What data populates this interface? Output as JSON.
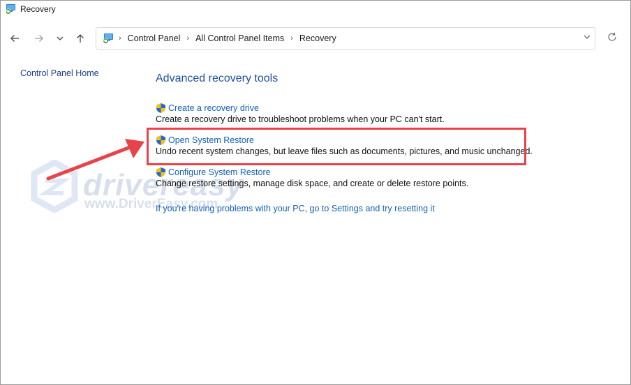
{
  "window": {
    "title": "Recovery"
  },
  "address": {
    "crumbs": [
      "Control Panel",
      "All Control Panel Items",
      "Recovery"
    ]
  },
  "left_pane": {
    "home_link": "Control Panel Home"
  },
  "main": {
    "heading": "Advanced recovery tools",
    "items": [
      {
        "label": "Create a recovery drive",
        "description": "Create a recovery drive to troubleshoot problems when your PC can't start."
      },
      {
        "label": "Open System Restore",
        "description": "Undo recent system changes, but leave files such as documents, pictures, and music unchanged."
      },
      {
        "label": "Configure System Restore",
        "description": "Change restore settings, manage disk space, and create or delete restore points."
      }
    ],
    "reset_link": "If you're having problems with your PC, go to Settings and try resetting it"
  },
  "watermark": {
    "brand": "drivereasy",
    "url": "www.DriverEasy.com"
  },
  "colors": {
    "link": "#1560b7",
    "heading": "#1c4fa0",
    "highlight": "#e8434a"
  },
  "icons": {
    "title": "control-panel-recovery-icon",
    "back": "arrow-left-icon",
    "forward": "arrow-right-icon",
    "recent": "chevron-down-icon",
    "up": "arrow-up-icon",
    "refresh": "refresh-icon",
    "item": "uac-shield-icon"
  }
}
